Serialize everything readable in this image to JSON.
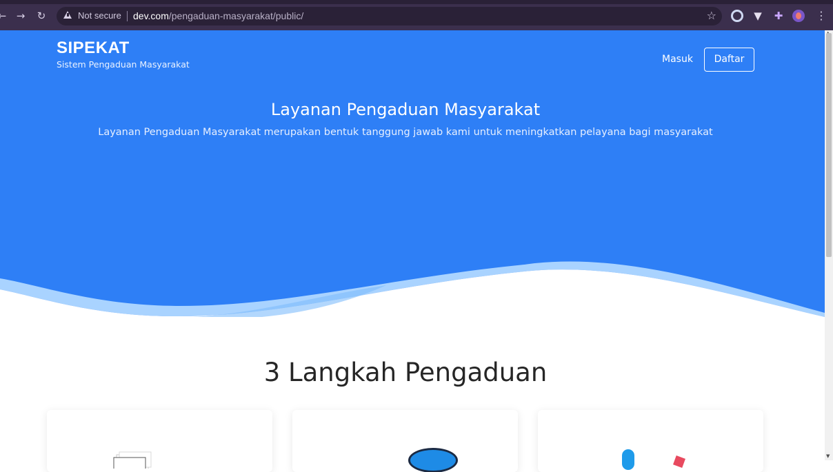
{
  "browser": {
    "security_label": "Not secure",
    "url_host": "dev.com",
    "url_path": "/pengaduan-masyarakat/public/"
  },
  "header": {
    "brand": "SIPEKAT",
    "tagline": "Sistem Pengaduan Masyarakat",
    "login_label": "Masuk",
    "register_label": "Daftar"
  },
  "hero": {
    "title": "Layanan Pengaduan Masyarakat",
    "subtitle": "Layanan Pengaduan Masyarakat merupakan bentuk tanggung jawab kami untuk meningkatkan pelayana bagi masyarakat"
  },
  "steps": {
    "title": "3 Langkah Pengaduan"
  },
  "colors": {
    "hero_blue": "#2e7ff6",
    "wave_light": "#a9d3ff",
    "chrome_bg": "#3b2f4d"
  }
}
